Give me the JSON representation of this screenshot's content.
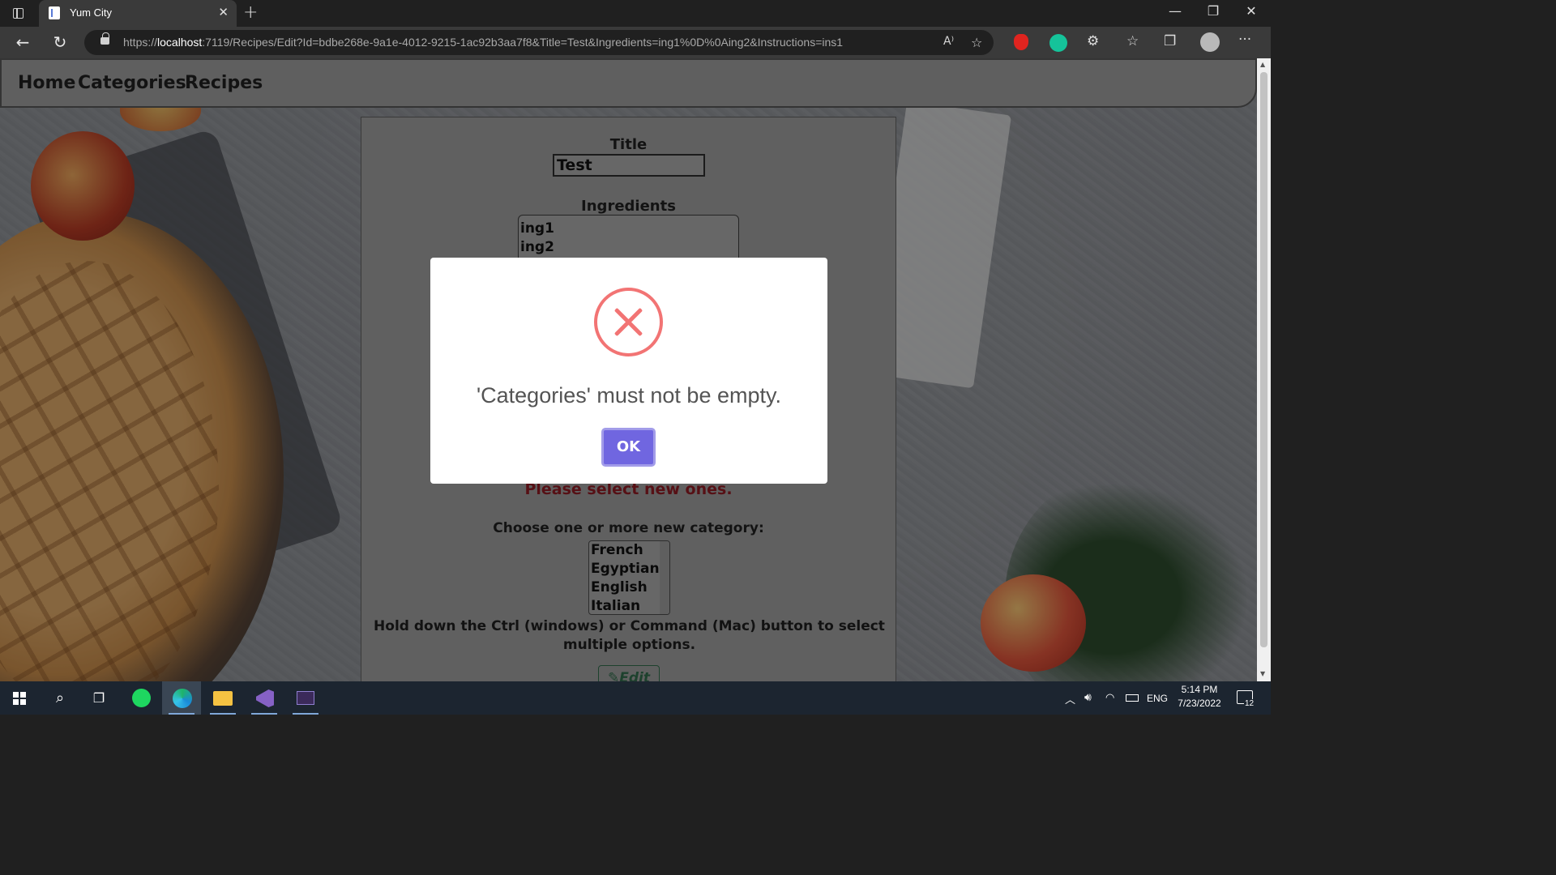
{
  "browser": {
    "tab_title": "Yum City",
    "tab_close": "✕",
    "new_tab": "+",
    "url_prefix": "https://",
    "url_host": "localhost",
    "url_rest": ":7119/Recipes/Edit?Id=bdbe268e-9a1e-4012-9215-1ac92b3aa7f8&Title=Test&Ingredients=ing1%0D%0Aing2&Instructions=ins1",
    "minimize": "—",
    "restore": "❐",
    "close": "✕",
    "read_aloud": "A⁾",
    "more": "···"
  },
  "navbar": {
    "home": "Home",
    "categories": "Categories",
    "recipes": "Recipes"
  },
  "form": {
    "title_label": "Title",
    "title_value": "Test",
    "ingredients_label": "Ingredients",
    "ingredients_lines": [
      "ing1",
      "ing2"
    ],
    "error_text": "Please select new ones.",
    "choose_label": "Choose one or more new category:",
    "category_options": [
      "French",
      "Egyptian",
      "English",
      "Italian"
    ],
    "hint": "Hold down the Ctrl (windows) or Command (Mac) button to select multiple options.",
    "edit_button": "Edit"
  },
  "modal": {
    "message": "'Categories' must not be empty.",
    "ok_label": "OK",
    "icon_color": "#f27474",
    "button_color": "#7066e0"
  },
  "taskbar": {
    "time": "5:14 PM",
    "date": "7/23/2022",
    "language": "ENG",
    "notification_count": "12"
  }
}
